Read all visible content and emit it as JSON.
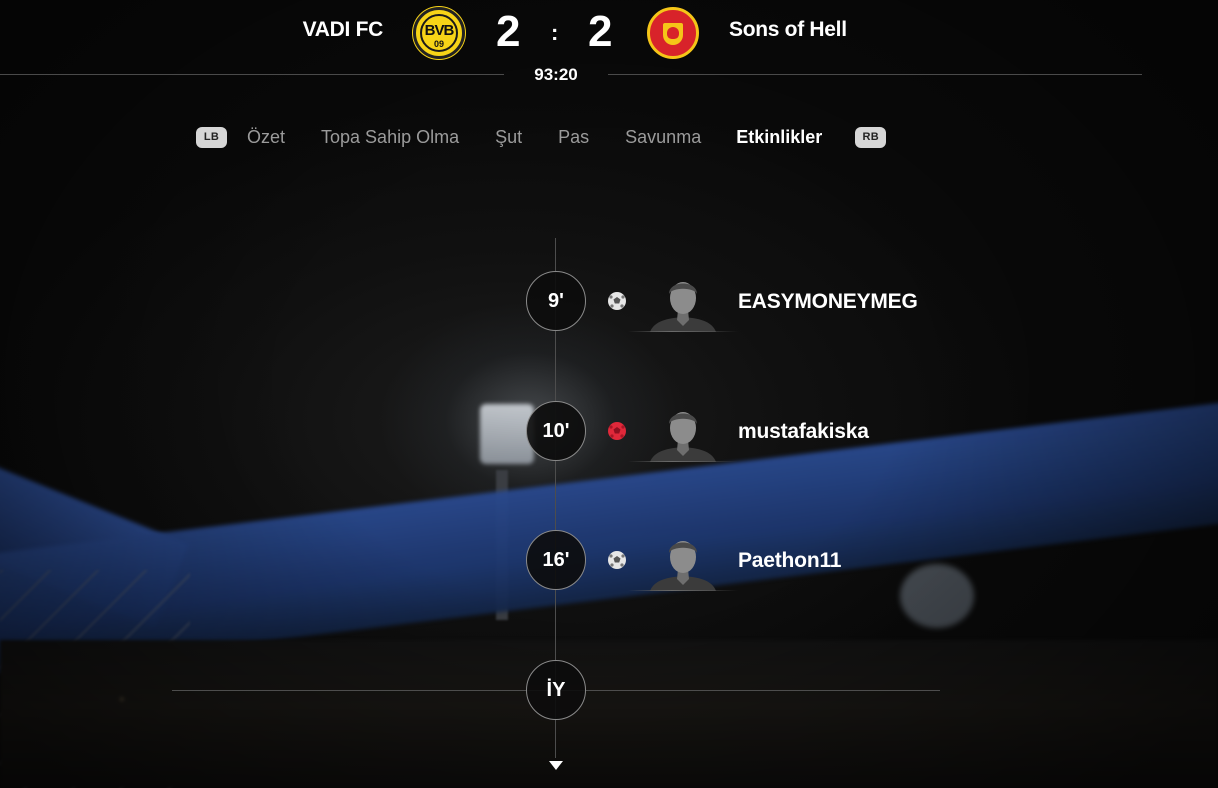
{
  "match": {
    "home_team": "VADI FC",
    "home_crest_text": "BVB",
    "home_crest_year": "09",
    "home_crest_color": "#f7d417",
    "home_score": "2",
    "separator": ":",
    "away_score": "2",
    "away_team": "Sons of Hell",
    "away_crest_color": "#d8232a",
    "clock": "93:20"
  },
  "tabs": {
    "left_bumper": "LB",
    "right_bumper": "RB",
    "items": [
      {
        "label": "Özet",
        "active": false
      },
      {
        "label": "Topa Sahip Olma",
        "active": false
      },
      {
        "label": "Şut",
        "active": false
      },
      {
        "label": "Pas",
        "active": false
      },
      {
        "label": "Savunma",
        "active": false
      },
      {
        "label": "Etkinlikler",
        "active": true
      }
    ]
  },
  "events": [
    {
      "minute": "9'",
      "type": "goal",
      "ball_icon": "ball-white-icon",
      "player": "EASYMONEYMEG"
    },
    {
      "minute": "10'",
      "type": "goal",
      "ball_icon": "ball-red-icon",
      "player": "mustafakiska"
    },
    {
      "minute": "16'",
      "type": "goal",
      "ball_icon": "ball-white-icon",
      "player": "Paethon11"
    }
  ],
  "halftime": {
    "label": "İY"
  },
  "colors": {
    "tab_active": "#ffffff",
    "tab_inactive": "#9b9b9b",
    "ball_red": "#e0283a",
    "ball_white": "#e6e6e6"
  }
}
